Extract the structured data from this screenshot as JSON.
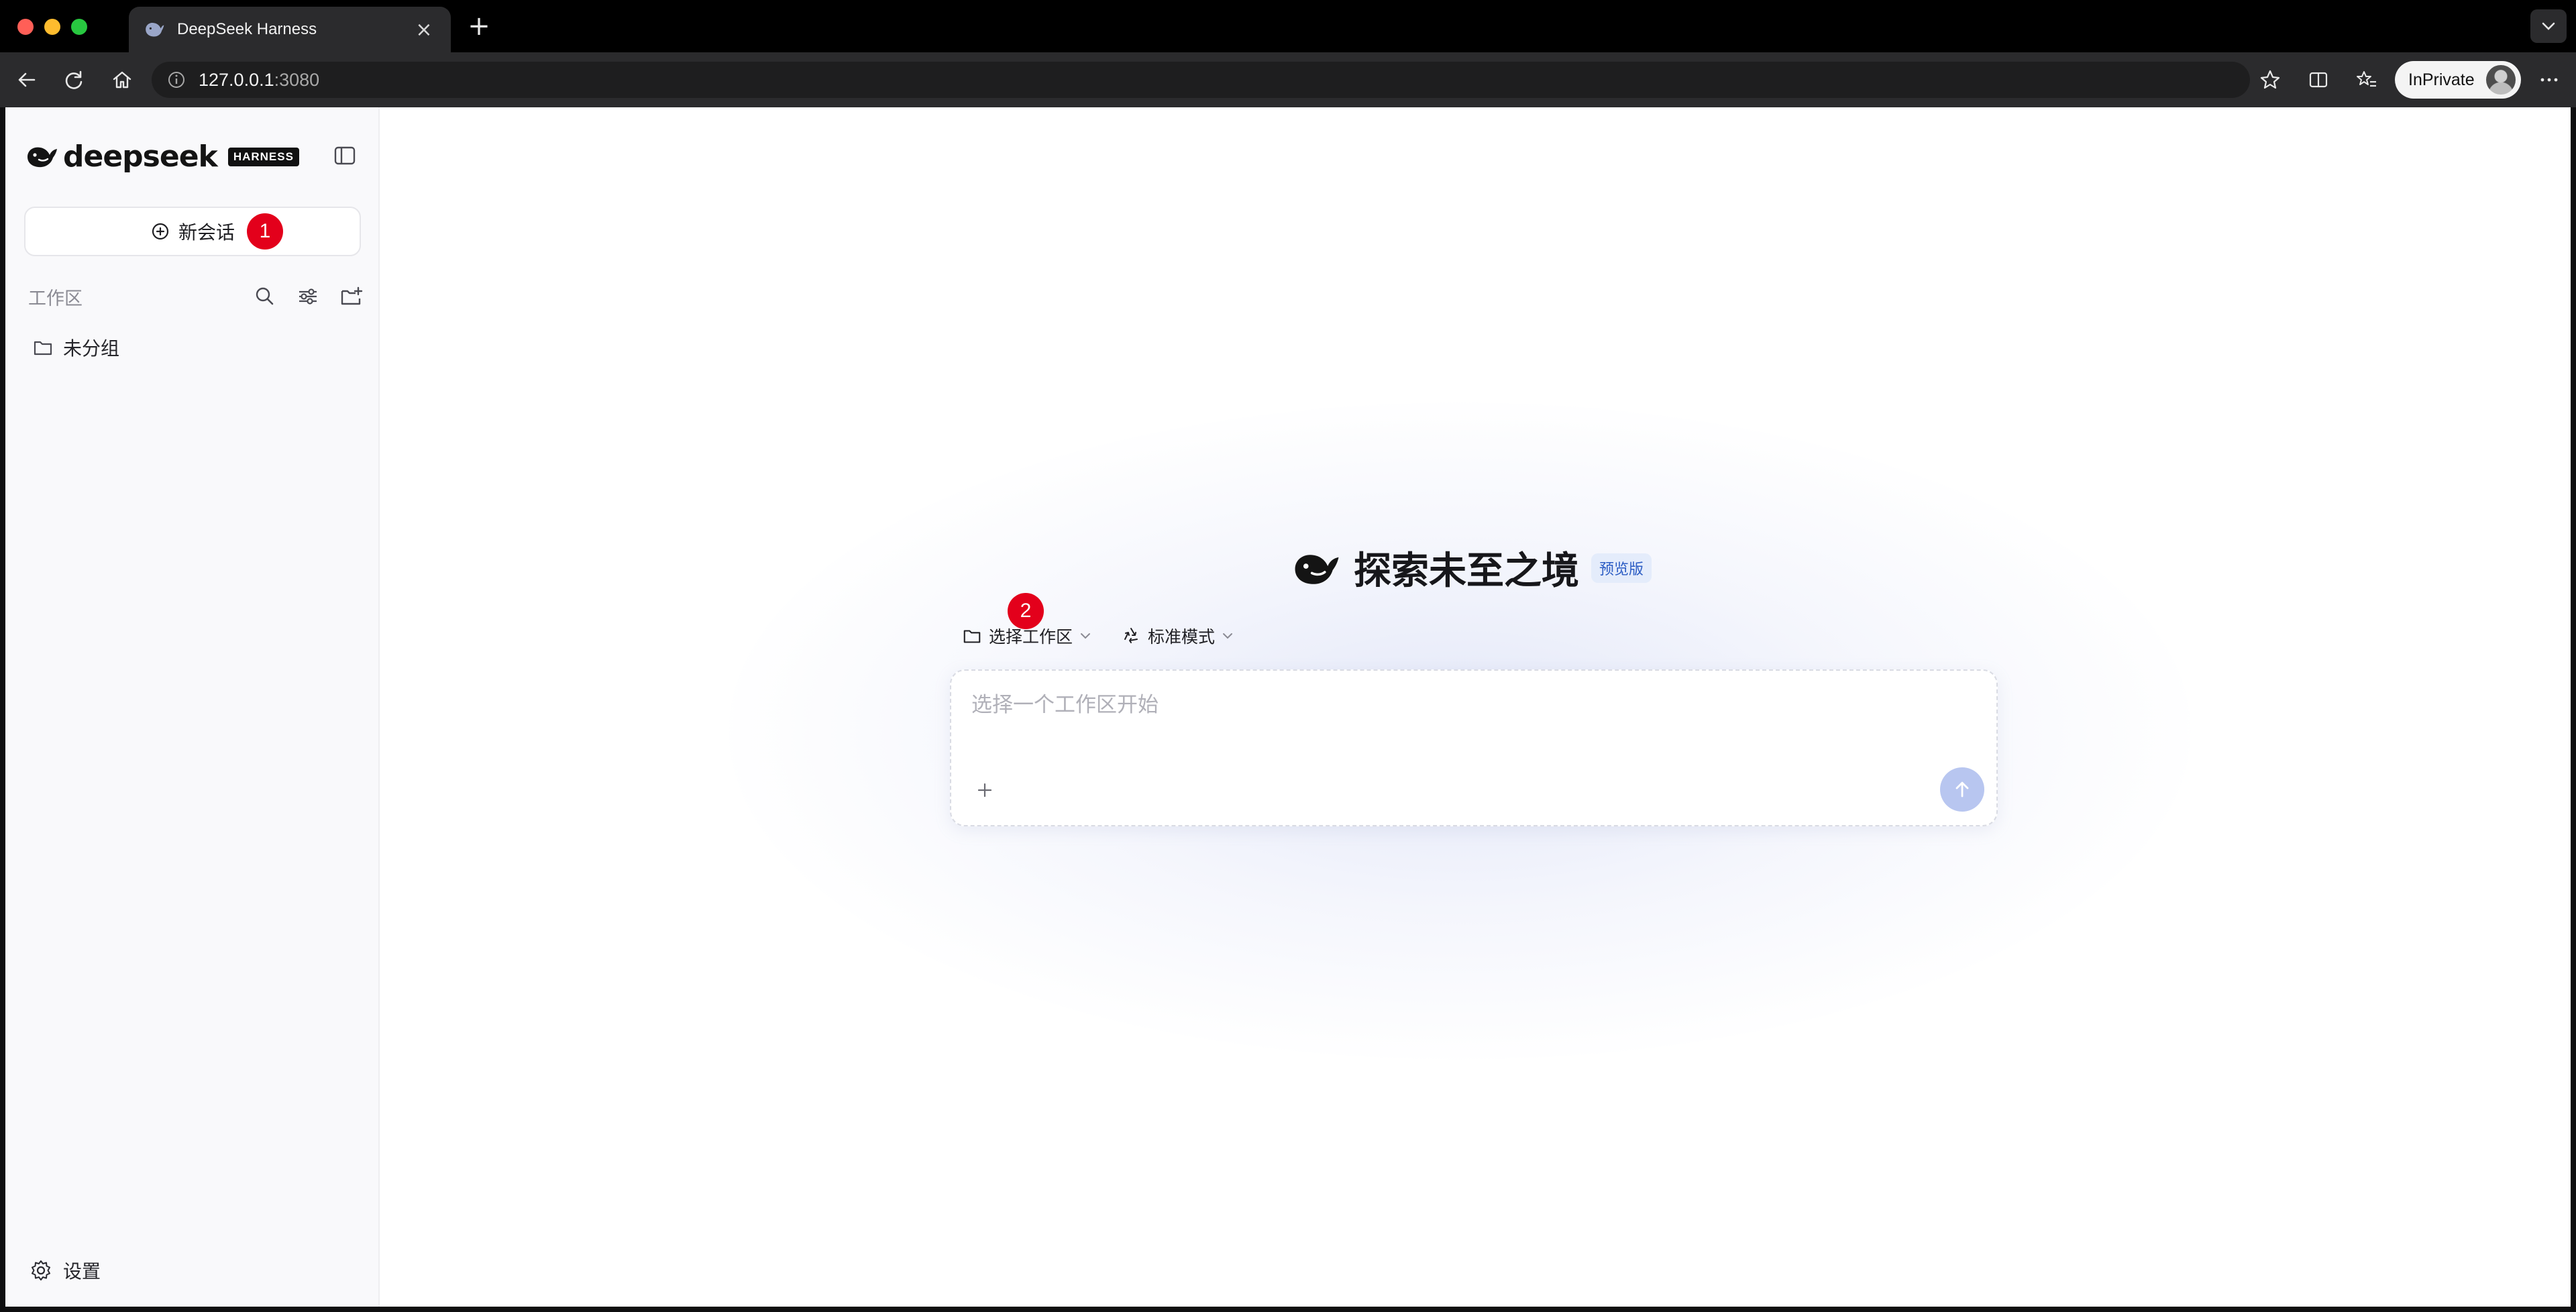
{
  "browser": {
    "tab_title": "DeepSeek Harness",
    "tab_close": "×",
    "new_tab": "+",
    "address_host": "127.0.0.1",
    "address_port": ":3080",
    "profile_label": "InPrivate"
  },
  "sidebar": {
    "logo_text": "deepseek",
    "logo_tag": "HARNESS",
    "new_chat_label": "新会话",
    "new_chat_badge": "1",
    "workspace_label": "工作区",
    "groups": [
      {
        "label": "未分组"
      }
    ],
    "settings_label": "设置"
  },
  "main": {
    "hero_title": "探索未至之境",
    "preview_badge": "预览版",
    "workspace_picker_label": "选择工作区",
    "workspace_picker_badge": "2",
    "mode_picker_label": "标准模式",
    "composer_placeholder": "选择一个工作区开始"
  },
  "colors": {
    "badge_red": "#e3001b",
    "send_button": "#b8c6f0",
    "preview_badge_bg": "#e4ecfb",
    "preview_badge_fg": "#2b5cc4"
  },
  "icons": {
    "tab_favicon": "deepseek-whale-icon",
    "sidebar_toggle": "sidebar-panel-icon",
    "new_chat": "plus-circle-icon",
    "search": "search-icon",
    "filter": "sliders-icon",
    "new_folder": "folder-plus-icon",
    "group": "folder-icon",
    "settings": "gear-icon",
    "mode": "recycle-icon",
    "attach": "plus-icon",
    "send": "arrow-up-icon"
  }
}
